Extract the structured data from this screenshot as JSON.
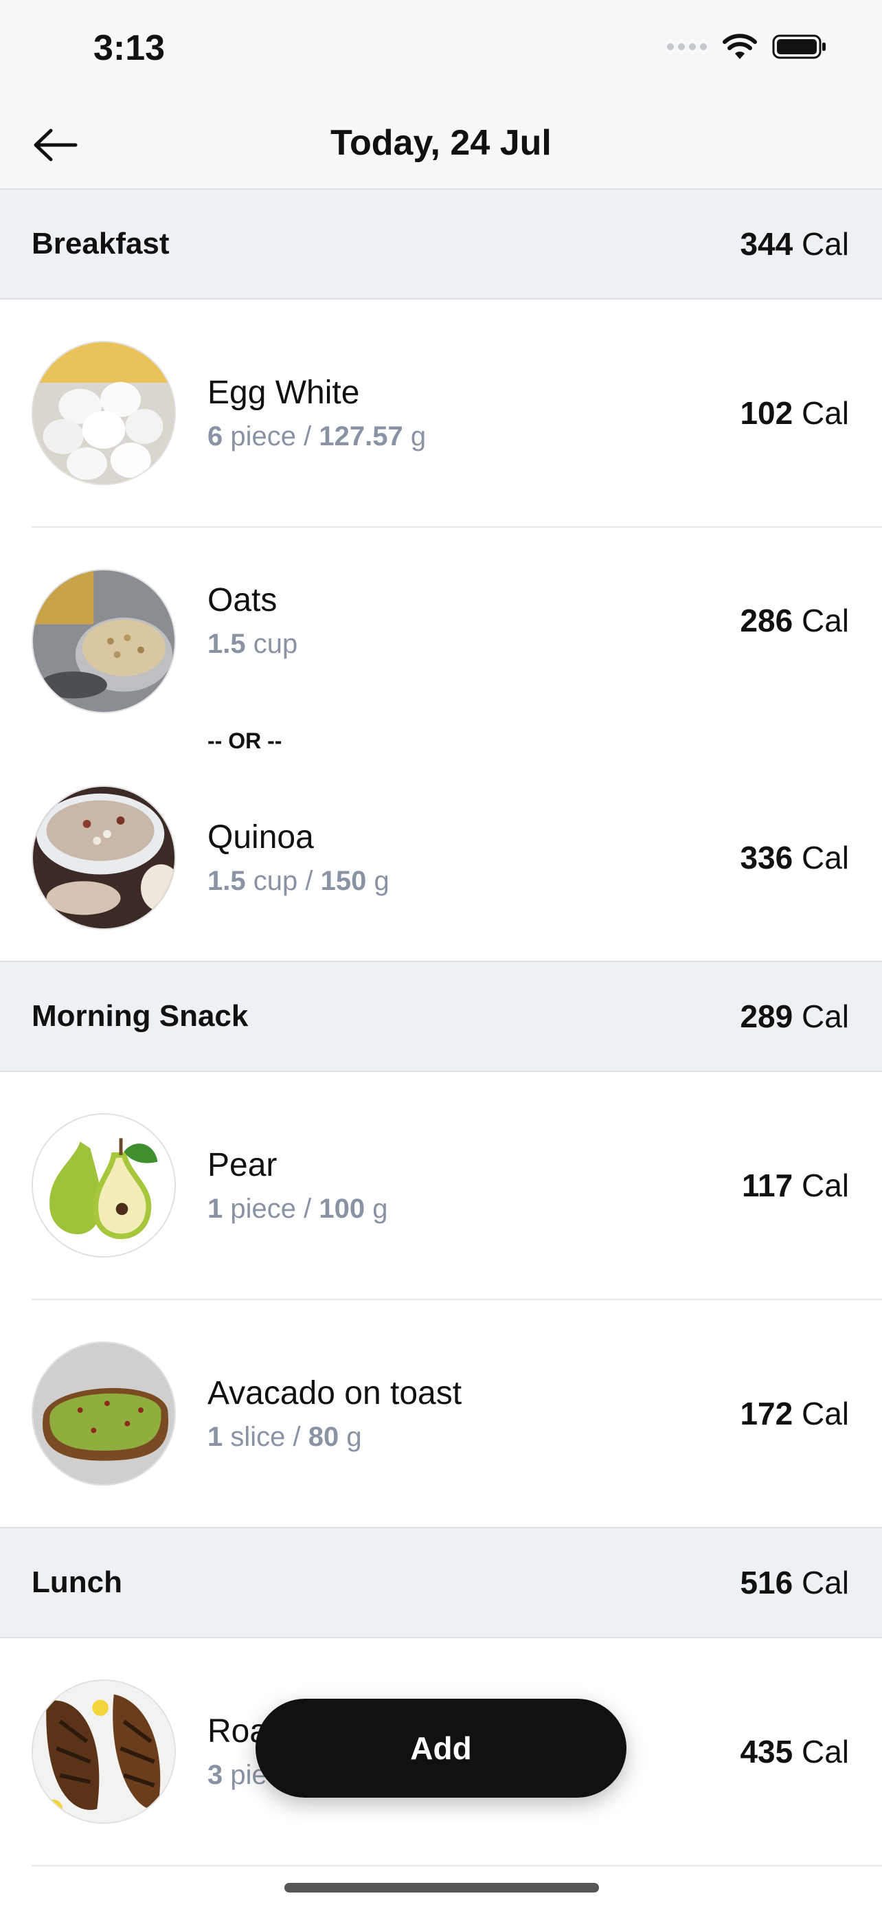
{
  "status_bar": {
    "time": "3:13"
  },
  "nav": {
    "title": "Today, 24 Jul"
  },
  "sections": [
    {
      "name": "Breakfast",
      "cal_value": "344",
      "cal_unit": "Cal",
      "items": [
        {
          "name": "Egg White",
          "qty1": "6",
          "unit1": "piece",
          "sep": "/",
          "qty2": "127.57",
          "unit2": "g",
          "cal_value": "102",
          "cal_unit": "Cal",
          "image": "egg-white-image"
        },
        {
          "name": "Oats",
          "qty1": "1.5",
          "unit1": "cup",
          "cal_value": "286",
          "cal_unit": "Cal",
          "image": "oats-image"
        },
        {
          "name": "Quinoa",
          "qty1": "1.5",
          "unit1": "cup",
          "sep": "/",
          "qty2": "150",
          "unit2": "g",
          "cal_value": "336",
          "cal_unit": "Cal",
          "image": "quinoa-image"
        }
      ],
      "or_label": "-- OR --"
    },
    {
      "name": "Morning Snack",
      "cal_value": "289",
      "cal_unit": "Cal",
      "items": [
        {
          "name": "Pear",
          "qty1": "1",
          "unit1": "piece",
          "sep": "/",
          "qty2": "100",
          "unit2": "g",
          "cal_value": "117",
          "cal_unit": "Cal",
          "image": "pear-image"
        },
        {
          "name": "Avacado on toast",
          "qty1": "1",
          "unit1": "slice",
          "sep": "/",
          "qty2": "80",
          "unit2": "g",
          "cal_value": "172",
          "cal_unit": "Cal",
          "image": "avocado-toast-image"
        }
      ]
    },
    {
      "name": "Lunch",
      "cal_value": "516",
      "cal_unit": "Cal",
      "items": [
        {
          "name": "Roa",
          "qty1": "3",
          "unit1": "pie",
          "cal_value": "435",
          "cal_unit": "Cal",
          "image": "roast-fish-image"
        }
      ]
    }
  ],
  "add_button": {
    "label": "Add"
  },
  "colors": {
    "section_bg": "#eef1f4",
    "portion_text": "#8a93a3",
    "button_bg": "#111111"
  }
}
